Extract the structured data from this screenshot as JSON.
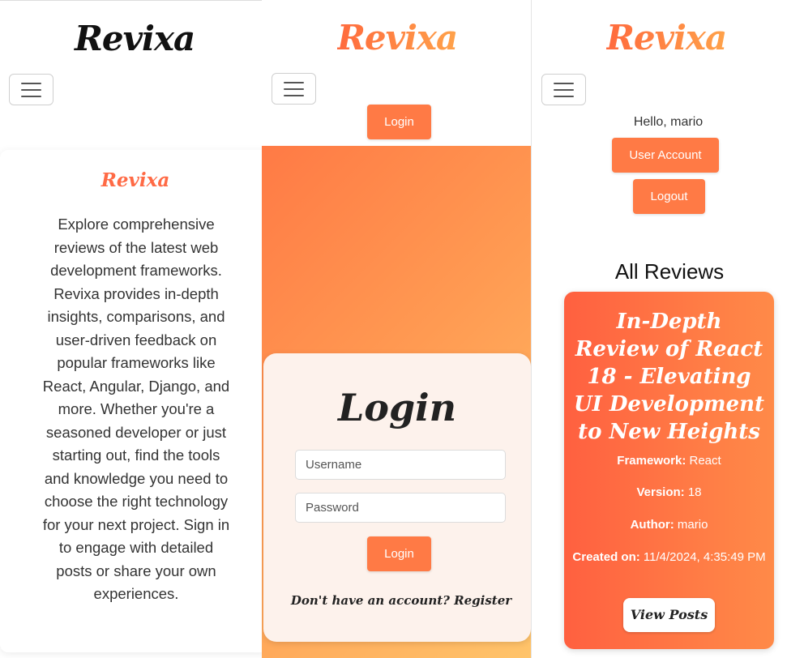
{
  "colors": {
    "brand_orange": "#ff7a45",
    "gradient_start": "#ff7a45",
    "gradient_end": "#ffc46a",
    "card_bg": "#fdf2ec"
  },
  "brand": {
    "name": "Revixa"
  },
  "menu_icon": "hamburger-menu-icon",
  "panel_about": {
    "card_title": "Revixa",
    "description": "Explore comprehensive reviews of the latest web development frameworks. Revixa provides in-depth insights, comparisons, and user-driven feedback on popular frameworks like React, Angular, Django, and more. Whether you're a seasoned developer or just starting out, find the tools and knowledge you need to choose the right technology for your next project. Sign in to engage with detailed posts or share your own experiences."
  },
  "panel_login": {
    "nav_login_label": "Login",
    "heading": "Login",
    "username_placeholder": "Username",
    "password_placeholder": "Password",
    "submit_label": "Login",
    "register_prompt": "Don't have an account? Register"
  },
  "panel_reviews": {
    "greeting": "Hello, mario",
    "user_account_label": "User Account",
    "logout_label": "Logout",
    "section_heading": "All Reviews",
    "review": {
      "title": "In-Depth Review of React 18 - Elevating UI Development to New Heights",
      "framework_label": "Framework:",
      "framework": "React",
      "version_label": "Version:",
      "version": "18",
      "author_label": "Author:",
      "author": "mario",
      "created_label": "Created on:",
      "created": "11/4/2024, 4:35:49 PM",
      "view_posts_label": "View Posts"
    }
  }
}
